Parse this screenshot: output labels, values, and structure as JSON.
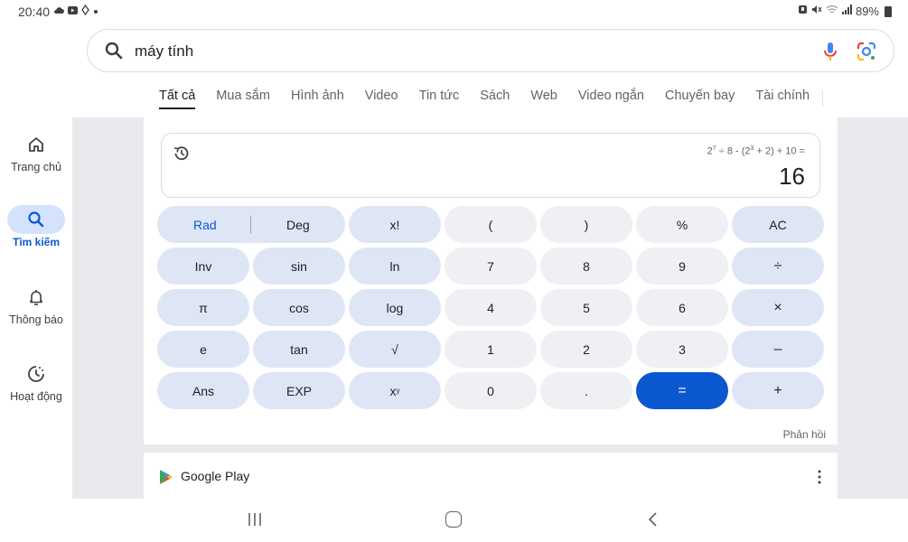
{
  "status_bar": {
    "time": "20:40",
    "left_icons": [
      "cloud-icon",
      "youtube-icon",
      "location-icon",
      "dot-icon"
    ],
    "battery": "89%",
    "right_icons": [
      "alarm-icon",
      "mute-icon",
      "wifi-icon",
      "signal-icon",
      "battery-icon"
    ]
  },
  "search": {
    "query": "máy tính"
  },
  "tabs": [
    {
      "label": "Tất cả",
      "active": true
    },
    {
      "label": "Mua sắm",
      "active": false
    },
    {
      "label": "Hình ảnh",
      "active": false
    },
    {
      "label": "Video",
      "active": false
    },
    {
      "label": "Tin tức",
      "active": false
    },
    {
      "label": "Sách",
      "active": false
    },
    {
      "label": "Web",
      "active": false
    },
    {
      "label": "Video ngắn",
      "active": false
    },
    {
      "label": "Chuyến bay",
      "active": false
    },
    {
      "label": "Tài chính",
      "active": false
    }
  ],
  "rail": {
    "items": [
      {
        "label": "Trang chủ",
        "icon": "home-icon",
        "active": false
      },
      {
        "label": "Tìm kiếm",
        "icon": "search-icon",
        "active": true
      },
      {
        "label": "Thông báo",
        "icon": "bell-icon",
        "active": false
      },
      {
        "label": "Hoạt động",
        "icon": "activity-icon",
        "active": false
      }
    ]
  },
  "calculator": {
    "expr_part1": "2",
    "expr_sup1": "7",
    "expr_part2": " ÷ 8 - (2",
    "expr_sup2": "3",
    "expr_part3": " + 2) + 10 =",
    "result": "16",
    "keys": {
      "rad": "Rad",
      "deg": "Deg",
      "fact": "x!",
      "lparen": "(",
      "rparen": ")",
      "percent": "%",
      "ac": "AC",
      "inv": "Inv",
      "sin": "sin",
      "ln": "ln",
      "seven": "7",
      "eight": "8",
      "nine": "9",
      "divide": "÷",
      "pi": "π",
      "cos": "cos",
      "log": "log",
      "four": "4",
      "five": "5",
      "six": "6",
      "multiply": "×",
      "e": "e",
      "tan": "tan",
      "sqrt": "√",
      "one": "1",
      "two": "2",
      "three": "3",
      "minus": "–",
      "ans": "Ans",
      "exp": "EXP",
      "xy_base": "x",
      "xy_sup": "y",
      "zero": "0",
      "dot": ".",
      "equals": "=",
      "plus": "+"
    },
    "feedback": "Phản hồi"
  },
  "play_result": {
    "title": "Google Play"
  },
  "colors": {
    "accent": "#0b57d0",
    "func_key": "#dee6f6",
    "num_key": "#eef0f3",
    "backdrop": "#e8eaed"
  }
}
